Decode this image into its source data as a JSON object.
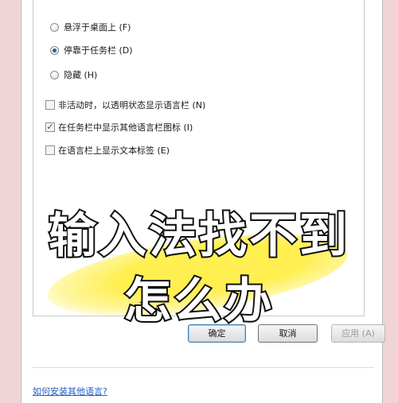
{
  "language_bar": {
    "options": [
      {
        "label": "悬浮于桌面上 (F)",
        "checked": false
      },
      {
        "label": "停靠于任务栏 (D)",
        "checked": true
      },
      {
        "label": "隐藏 (H)",
        "checked": false
      }
    ],
    "checkboxes": [
      {
        "label": "非活动时，以透明状态显示语言栏 (N)",
        "checked": false
      },
      {
        "label": "在任务栏中显示其他语言栏图标 (I)",
        "checked": true
      },
      {
        "label": "在语言栏上显示文本标签 (E)",
        "checked": false
      }
    ]
  },
  "buttons": {
    "ok": "确定",
    "cancel": "取消",
    "apply": "应用 (A)"
  },
  "help_link": "如何安装其他语言?",
  "overlay": {
    "line1": "输入法找不到",
    "line2": "怎么办",
    "highlight_color": "#ffee46"
  }
}
